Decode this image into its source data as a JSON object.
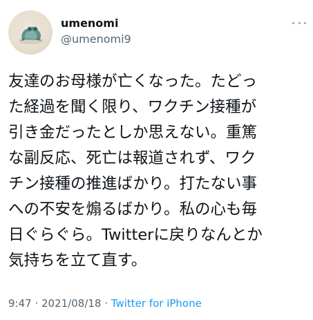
{
  "user": {
    "display_name": "umenomi",
    "handle": "@umenomi9"
  },
  "tweet": {
    "lines": [
      "友達のお母様が亡くなった。たどっ",
      "た経過を聞く限り、ワクチン接種が",
      "引き金だったとしか思えない。重篤",
      "な副反応、死亡は報道されず、ワク",
      "チン接種の推進ばかり。打たない事",
      "への不安を煽るばかり。私の心も毎",
      "日ぐらぐら。Twitterに戻りなんとか",
      "気持ちを立て直す。"
    ],
    "time": "9:47",
    "separator": " · ",
    "date": "2021/08/18",
    "source": "Twitter for iPhone"
  },
  "icons": {
    "avatar": "frog-figurine-avatar",
    "more": "more-dots-icon"
  },
  "colors": {
    "text": "#0f1419",
    "secondary": "#536471",
    "link": "#1d9bf0"
  }
}
